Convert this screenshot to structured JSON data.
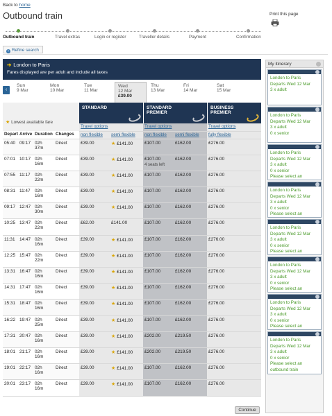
{
  "header": {
    "back_prefix": "Back to ",
    "back_link": "home",
    "title": "Outbound train",
    "print_label": "Print this page"
  },
  "steps": [
    {
      "label": "Outbound train",
      "active": true
    },
    {
      "label": "Travel extras",
      "active": false
    },
    {
      "label": "Login or register",
      "active": false
    },
    {
      "label": "Traveller details",
      "active": false
    },
    {
      "label": "Payment",
      "active": false
    },
    {
      "label": "Confirmation",
      "active": false
    }
  ],
  "refine_label": "Refine search",
  "banner": {
    "route": "London to Paris",
    "note": "Fares displayed are per adult and include all taxes"
  },
  "dates": [
    {
      "day": "Sun",
      "date": "9 Mar",
      "price": ""
    },
    {
      "day": "Mon",
      "date": "10 Mar",
      "price": ""
    },
    {
      "day": "Tue",
      "date": "11 Mar",
      "price": ""
    },
    {
      "day": "Wed",
      "date": "12 Mar",
      "price": "£39.00",
      "selected": true
    },
    {
      "day": "Thu",
      "date": "13 Mar",
      "price": ""
    },
    {
      "day": "Fri",
      "date": "14 Mar",
      "price": ""
    },
    {
      "day": "Sat",
      "date": "15 Mar",
      "price": ""
    }
  ],
  "classes": {
    "standard": "STANDARD",
    "premier_1": "STANDARD",
    "premier_2": "PREMIER",
    "business_1": "BUSINESS",
    "business_2": "PREMIER",
    "lowest_fare": "Lowest available fare",
    "travel_options": "Travel options"
  },
  "columns": {
    "depart": "Depart",
    "arrive": "Arrive",
    "duration": "Duration",
    "changes": "Changes",
    "non_flexible": "non flexible",
    "semi_flexible": "semi flexible",
    "fully_flexible": "fully flexible"
  },
  "trains": [
    {
      "dep": "05:40",
      "arr": "09:17",
      "dur1": "02h",
      "dur2": "37m",
      "chg": "Direct",
      "s_nf": "£39.00",
      "s_sf": "£141.00",
      "p_nf": "£107.00",
      "p_sf": "£162.00",
      "b_ff": "£276.00",
      "seats": ""
    },
    {
      "dep": "07:01",
      "arr": "10:17",
      "dur1": "02h",
      "dur2": "16m",
      "chg": "Direct",
      "s_nf": "£39.00",
      "s_sf": "£141.00",
      "p_nf": "£107.00",
      "p_sf": "£162.00",
      "b_ff": "£276.00",
      "seats": "4 seats left"
    },
    {
      "dep": "07:55",
      "arr": "11:17",
      "dur1": "02h",
      "dur2": "22m",
      "chg": "Direct",
      "s_nf": "£39.00",
      "s_sf": "£141.00",
      "p_nf": "£107.00",
      "p_sf": "£162.00",
      "b_ff": "£276.00",
      "seats": ""
    },
    {
      "dep": "08:31",
      "arr": "11:47",
      "dur1": "02h",
      "dur2": "16m",
      "chg": "Direct",
      "s_nf": "£39.00",
      "s_sf": "£141.00",
      "p_nf": "£107.00",
      "p_sf": "£162.00",
      "b_ff": "£276.00",
      "seats": ""
    },
    {
      "dep": "09:17",
      "arr": "12:47",
      "dur1": "02h",
      "dur2": "30m",
      "chg": "Direct",
      "s_nf": "£39.00",
      "s_sf": "£141.00",
      "p_nf": "£107.00",
      "p_sf": "£162.00",
      "b_ff": "£276.00",
      "seats": ""
    },
    {
      "dep": "10:25",
      "arr": "13:47",
      "dur1": "02h",
      "dur2": "22m",
      "chg": "Direct",
      "s_nf": "£62.00",
      "s_sf": "£141.00",
      "p_nf": "£107.00",
      "p_sf": "£162.00",
      "b_ff": "£276.00",
      "seats": "",
      "nostar": true
    },
    {
      "dep": "11:31",
      "arr": "14:47",
      "dur1": "02h",
      "dur2": "16m",
      "chg": "Direct",
      "s_nf": "£39.00",
      "s_sf": "£141.00",
      "p_nf": "£107.00",
      "p_sf": "£162.00",
      "b_ff": "£276.00",
      "seats": ""
    },
    {
      "dep": "12:25",
      "arr": "15:47",
      "dur1": "02h",
      "dur2": "22m",
      "chg": "Direct",
      "s_nf": "£39.00",
      "s_sf": "£141.00",
      "p_nf": "£107.00",
      "p_sf": "£162.00",
      "b_ff": "£276.00",
      "seats": ""
    },
    {
      "dep": "13:31",
      "arr": "16:47",
      "dur1": "02h",
      "dur2": "16m",
      "chg": "Direct",
      "s_nf": "£39.00",
      "s_sf": "£141.00",
      "p_nf": "£107.00",
      "p_sf": "£162.00",
      "b_ff": "£276.00",
      "seats": ""
    },
    {
      "dep": "14:31",
      "arr": "17:47",
      "dur1": "02h",
      "dur2": "16m",
      "chg": "Direct",
      "s_nf": "£39.00",
      "s_sf": "£141.00",
      "p_nf": "£107.00",
      "p_sf": "£162.00",
      "b_ff": "£276.00",
      "seats": ""
    },
    {
      "dep": "15:31",
      "arr": "18:47",
      "dur1": "02h",
      "dur2": "16m",
      "chg": "Direct",
      "s_nf": "£39.00",
      "s_sf": "£141.00",
      "p_nf": "£107.00",
      "p_sf": "£162.00",
      "b_ff": "£276.00",
      "seats": ""
    },
    {
      "dep": "16:22",
      "arr": "19:47",
      "dur1": "02h",
      "dur2": "25m",
      "chg": "Direct",
      "s_nf": "£39.00",
      "s_sf": "£141.00",
      "p_nf": "£107.00",
      "p_sf": "£162.00",
      "b_ff": "£276.00",
      "seats": ""
    },
    {
      "dep": "17:31",
      "arr": "20:47",
      "dur1": "02h",
      "dur2": "16m",
      "chg": "Direct",
      "s_nf": "£39.00",
      "s_sf": "£141.00",
      "p_nf": "£202.00",
      "p_sf": "£219.50",
      "b_ff": "£276.00",
      "seats": ""
    },
    {
      "dep": "18:01",
      "arr": "21:17",
      "dur1": "02h",
      "dur2": "16m",
      "chg": "Direct",
      "s_nf": "£39.00",
      "s_sf": "£141.00",
      "p_nf": "£202.00",
      "p_sf": "£219.50",
      "b_ff": "£276.00",
      "seats": ""
    },
    {
      "dep": "19:01",
      "arr": "22:17",
      "dur1": "02h",
      "dur2": "16m",
      "chg": "Direct",
      "s_nf": "£39.00",
      "s_sf": "£141.00",
      "p_nf": "£107.00",
      "p_sf": "£162.00",
      "b_ff": "£276.00",
      "seats": ""
    },
    {
      "dep": "20:01",
      "arr": "23:17",
      "dur1": "02h",
      "dur2": "16m",
      "chg": "Direct",
      "s_nf": "£39.00",
      "s_sf": "£141.00",
      "p_nf": "£107.00",
      "p_sf": "£162.00",
      "b_ff": "£276.00",
      "seats": ""
    }
  ],
  "continue_label": "Continue",
  "itinerary": {
    "title": "My itinerary",
    "cards": [
      {
        "lines": [
          "London to Paris",
          "Departs Wed 12 Mar",
          "3 x adult"
        ]
      },
      {
        "lines": [
          "London to Paris",
          "Departs Wed 12 Mar",
          "3 x adult",
          "0 x senior"
        ]
      },
      {
        "lines": [
          "London to Paris",
          "Departs Wed 12 Mar",
          "3 x adult",
          "0 x senior",
          "Please select an"
        ]
      },
      {
        "lines": [
          "London to Paris",
          "Departs Wed 12 Mar",
          "3 x adult",
          "0 x senior",
          "Please select an"
        ]
      },
      {
        "lines": [
          "London to Paris",
          "Departs Wed 12 Mar",
          "3 x adult",
          "0 x senior",
          "Please select an"
        ]
      },
      {
        "lines": [
          "London to Paris",
          "Departs Wed 12 Mar",
          "3 x adult",
          "0 x senior",
          "Please select an"
        ]
      },
      {
        "lines": [
          "London to Paris",
          "Departs Wed 12 Mar",
          "3 x adult",
          "0 x senior",
          "Please select an"
        ]
      },
      {
        "lines": [
          "London to Paris",
          "Departs Wed 12 Mar",
          "3 x adult",
          "0 x senior",
          "Please select an",
          "outbound train"
        ]
      }
    ]
  }
}
